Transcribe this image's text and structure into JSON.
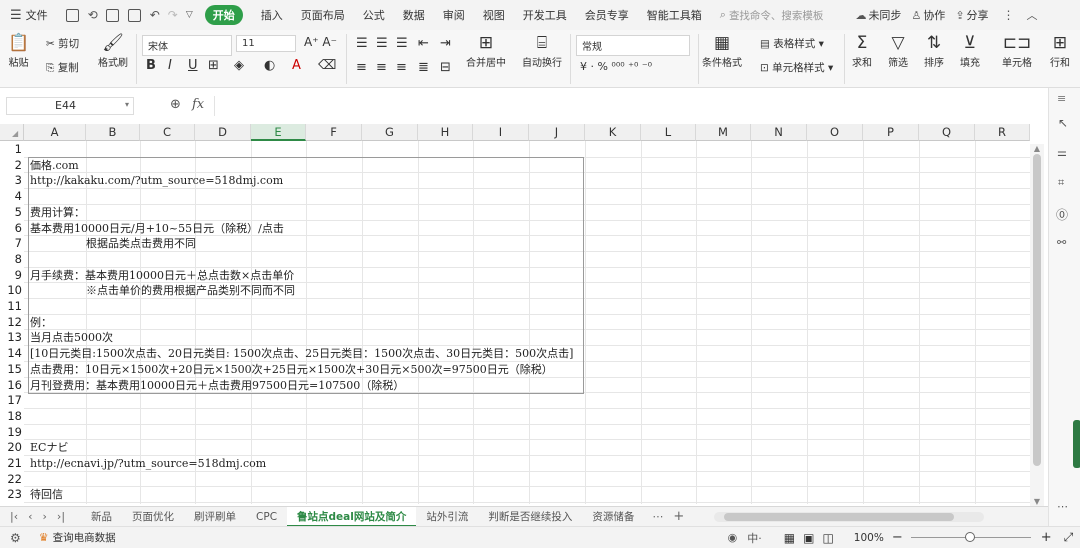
{
  "menu": {
    "file": "文件",
    "tabs": [
      "开始",
      "插入",
      "页面布局",
      "公式",
      "数据",
      "审阅",
      "视图",
      "开发工具",
      "会员专享",
      "智能工具箱"
    ],
    "active_tab": "开始",
    "search_placeholder": "查找命令、搜索模板",
    "unsynced": "未同步",
    "collab": "协作",
    "share": "分享"
  },
  "ribbon": {
    "paste": "粘贴",
    "cut": "剪切",
    "copy": "复制",
    "format_painter": "格式刷",
    "font_name": "宋体",
    "font_size": "11",
    "merge": "合并居中",
    "wrap": "自动换行",
    "number_format": "常规",
    "cond_format": "条件格式",
    "table_style": "表格样式",
    "cell_style": "单元格样式",
    "sum": "求和",
    "filter": "筛选",
    "sort": "排序",
    "fill": "填充",
    "cell": "单元格",
    "rowcol": "行和"
  },
  "formula_bar": {
    "cell_ref": "E44",
    "fx": "fx",
    "value": ""
  },
  "columns": [
    "A",
    "B",
    "C",
    "D",
    "E",
    "F",
    "G",
    "H",
    "I",
    "J",
    "K",
    "L",
    "M",
    "N",
    "O",
    "P",
    "Q",
    "R"
  ],
  "selected_column": "E",
  "rows": [
    "1",
    "2",
    "3",
    "4",
    "5",
    "6",
    "7",
    "8",
    "9",
    "10",
    "11",
    "12",
    "13",
    "14",
    "15",
    "16",
    "17",
    "18",
    "19",
    "20",
    "21",
    "22",
    "23"
  ],
  "cells": {
    "r2": "価格.com",
    "r3": "http://kakaku.com/?utm_source=518dmj.com",
    "r5": "费用计算：",
    "r6": "基本费用10000日元/月+10~55日元（除税）/点击",
    "r7": "根据品类点击费用不同",
    "r9": "月手续费：基本费用10000日元＋总点击数×点击单价",
    "r10": "※点击单价的费用根据产品类别不同而不同",
    "r12": "例：",
    "r13": "当月点击5000次",
    "r14": "[10日元类目:1500次点击、20日元类目: 1500次点击、25日元类目：1500次点击、30日元类目：500次点击]",
    "r15": "点击费用：10日元×1500次+20日元×1500次+25日元×1500次+30日元×500次=97500日元（除税）",
    "r16": "月刊登费用：基本费用10000日元＋点击费用97500日元=107500（除税）",
    "r20": "ECナビ",
    "r21": "http://ecnavi.jp/?utm_source=518dmj.com",
    "r23": "待回信"
  },
  "sheet_tabs": [
    "新品",
    "页面优化",
    "刷评刷单",
    "CPC",
    "鲁站点deal网站及简介",
    "站外引流",
    "判断是否继续投入",
    "资源储备"
  ],
  "active_sheet": "鲁站点deal网站及简介",
  "status": {
    "app_label": "查询电商数据",
    "zoom": "100%"
  },
  "colors": {
    "accent": "#2e9e49",
    "active_tab_text": "#2e8a46"
  }
}
